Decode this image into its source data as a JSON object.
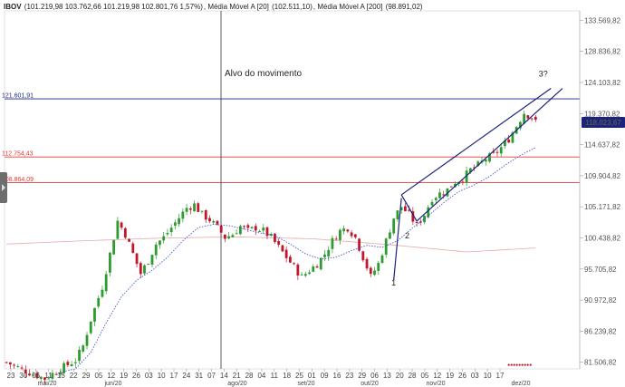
{
  "legend": {
    "symbol": "IBOV",
    "ohlc": "(101.219,98  103.762,66  101.219,98  102.801,76  1,57%)",
    "ma20_label": "Média Móvel A [20]",
    "ma20_value": "(102.511,10)",
    "ma200_label": "Média Móvel A [200]",
    "ma200_value": "(98.891,02)"
  },
  "colors": {
    "up": "#2e9b2e",
    "down": "#c0182a",
    "ma20": "#3344cc",
    "ma200": "#e8a8a8",
    "target_line": "#1a237e",
    "resistance": "#e53935",
    "price_badge": "#1a237e"
  },
  "chart_data": {
    "type": "candlestick",
    "y_axis": {
      "ticks": [
        "133.569,82",
        "128.836,82",
        "124.103,82",
        "119.370,82",
        "114.637,82",
        "109.904,82",
        "105.171,82",
        "100.438,82",
        "95.705,82",
        "90.972,82",
        "86.239,82",
        "81.506,82"
      ],
      "range": [
        80500,
        135000
      ]
    },
    "x_axis": {
      "day_ticks": [
        "23",
        "30",
        "06",
        "11",
        "15",
        "22",
        "29",
        "05",
        "12",
        "19",
        "26",
        "03",
        "10",
        "17",
        "24",
        "31",
        "07",
        "14",
        "21",
        "28",
        "04",
        "11",
        "18",
        "25",
        "01",
        "09",
        "16",
        "23",
        "29",
        "06",
        "13",
        "20",
        "28",
        "05",
        "12",
        "19",
        "26",
        "03",
        "10",
        "17"
      ],
      "month_labels": [
        "mai/20",
        "jun/20",
        "ago/20",
        "set/20",
        "out/20",
        "nov/20",
        "dez/20"
      ]
    },
    "horizontal_lines": [
      {
        "label": "121.601,91",
        "value": 121601.91
      },
      {
        "label": "112.754,43",
        "value": 112754.43
      },
      {
        "label": "108.864,09",
        "value": 108864.09
      }
    ],
    "annotation_text": "Alvo do movimento",
    "wave_labels": [
      "1",
      "2",
      "3?"
    ],
    "current_price_badge": "118.023,67",
    "close_path": [
      [
        0,
        81500
      ],
      [
        5,
        80200
      ],
      [
        10,
        79000
      ],
      [
        14,
        80500
      ],
      [
        18,
        81800
      ],
      [
        20,
        84000
      ],
      [
        22,
        88000
      ],
      [
        25,
        93000
      ],
      [
        27,
        98000
      ],
      [
        29,
        103000
      ],
      [
        31,
        101000
      ],
      [
        33,
        98000
      ],
      [
        35,
        95000
      ],
      [
        37,
        97000
      ],
      [
        39,
        99500
      ],
      [
        41,
        100500
      ],
      [
        43,
        102000
      ],
      [
        45,
        103500
      ],
      [
        47,
        105000
      ],
      [
        49,
        105500
      ],
      [
        51,
        104000
      ],
      [
        53,
        103200
      ],
      [
        55,
        102000
      ],
      [
        57,
        100500
      ],
      [
        59,
        101000
      ],
      [
        61,
        102200
      ],
      [
        63,
        101500
      ],
      [
        65,
        102000
      ],
      [
        67,
        101500
      ],
      [
        69,
        100500
      ],
      [
        71,
        99000
      ],
      [
        73,
        97500
      ],
      [
        75,
        96000
      ],
      [
        77,
        94500
      ],
      [
        79,
        95500
      ],
      [
        81,
        96500
      ],
      [
        83,
        98000
      ],
      [
        85,
        100000
      ],
      [
        87,
        101500
      ],
      [
        89,
        102000
      ],
      [
        91,
        100500
      ],
      [
        93,
        97500
      ],
      [
        95,
        94500
      ],
      [
        97,
        96500
      ],
      [
        99,
        100000
      ],
      [
        101,
        103500
      ],
      [
        103,
        105200
      ],
      [
        105,
        104000
      ],
      [
        107,
        102300
      ],
      [
        109,
        104000
      ],
      [
        111,
        106500
      ],
      [
        113,
        107200
      ],
      [
        115,
        107800
      ],
      [
        117,
        109000
      ],
      [
        119,
        109500
      ],
      [
        121,
        110800
      ],
      [
        123,
        111500
      ],
      [
        125,
        112500
      ],
      [
        127,
        113000
      ],
      [
        129,
        114200
      ],
      [
        131,
        115500
      ],
      [
        133,
        117500
      ],
      [
        135,
        119500
      ],
      [
        137,
        118800
      ],
      [
        138,
        118023
      ]
    ],
    "ma20_path": [
      [
        14,
        80000
      ],
      [
        18,
        80500
      ],
      [
        22,
        83000
      ],
      [
        26,
        87500
      ],
      [
        30,
        91500
      ],
      [
        34,
        94000
      ],
      [
        38,
        95500
      ],
      [
        42,
        97500
      ],
      [
        46,
        100000
      ],
      [
        50,
        102000
      ],
      [
        54,
        102500
      ],
      [
        58,
        102300
      ],
      [
        62,
        101800
      ],
      [
        66,
        101200
      ],
      [
        70,
        100800
      ],
      [
        74,
        99500
      ],
      [
        78,
        98000
      ],
      [
        82,
        97200
      ],
      [
        86,
        97500
      ],
      [
        90,
        98500
      ],
      [
        94,
        99300
      ],
      [
        98,
        99000
      ],
      [
        102,
        100000
      ],
      [
        106,
        102000
      ],
      [
        110,
        103800
      ],
      [
        114,
        105800
      ],
      [
        118,
        107500
      ],
      [
        122,
        108500
      ],
      [
        126,
        109800
      ],
      [
        130,
        111500
      ],
      [
        134,
        113000
      ],
      [
        138,
        114200
      ]
    ],
    "ma200_path": [
      [
        0,
        99500
      ],
      [
        20,
        100000
      ],
      [
        40,
        100400
      ],
      [
        60,
        100600
      ],
      [
        80,
        100300
      ],
      [
        100,
        99400
      ],
      [
        120,
        98300
      ],
      [
        138,
        98900
      ]
    ],
    "trend_lines": [
      {
        "from": [
          103,
          107000
        ],
        "to": [
          142,
          123200
        ]
      },
      {
        "from": [
          107,
          103000
        ],
        "to": [
          145,
          123200
        ]
      },
      {
        "from": [
          103,
          107000
        ],
        "to": [
          107,
          103000
        ]
      },
      {
        "from": [
          101,
          94000
        ],
        "to": [
          103,
          106500
        ]
      }
    ]
  }
}
